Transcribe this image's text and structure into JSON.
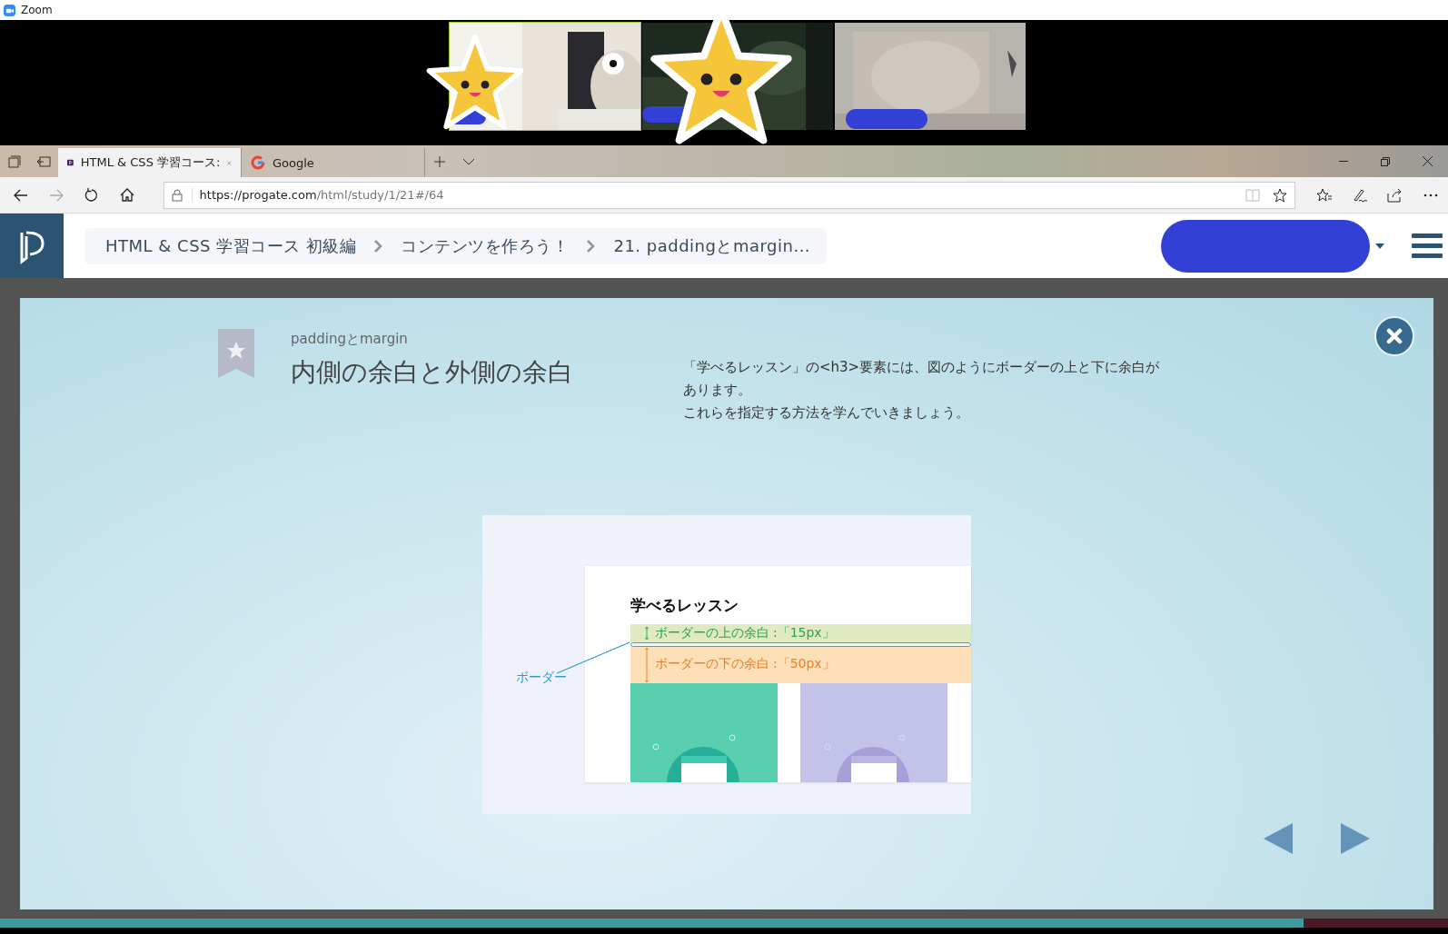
{
  "app": {
    "title": "Zoom"
  },
  "browser": {
    "tabs": [
      {
        "label": "HTML & CSS 学習コース:",
        "selected": true,
        "kind": "site"
      },
      {
        "label": "Google",
        "selected": false,
        "kind": "google"
      }
    ],
    "url_host": "https://progate.com",
    "url_path": "/html/study/1/21#/64"
  },
  "progress": {
    "level": 0.9
  },
  "breadcrumbs": [
    "HTML & CSS 学習コース 初級編",
    "コンテンツを作ろう！",
    "21. paddingとmargin..."
  ],
  "slide": {
    "subtitle": "paddingとmargin",
    "title": "内側の余白と外側の余白",
    "description": [
      "「学べるレッスン」の<h3>要素には、図のようにボーダーの上と下に余白が",
      "あります。",
      "これらを指定する方法を学んでいきましょう。"
    ],
    "figure": {
      "heading": "学べるレッスン",
      "top_margin_label": "ボーダーの上の余白 :「15px」",
      "bottom_margin_label": "ボーダーの下の余白 :「50px」",
      "border_label": "ボーダー"
    }
  }
}
